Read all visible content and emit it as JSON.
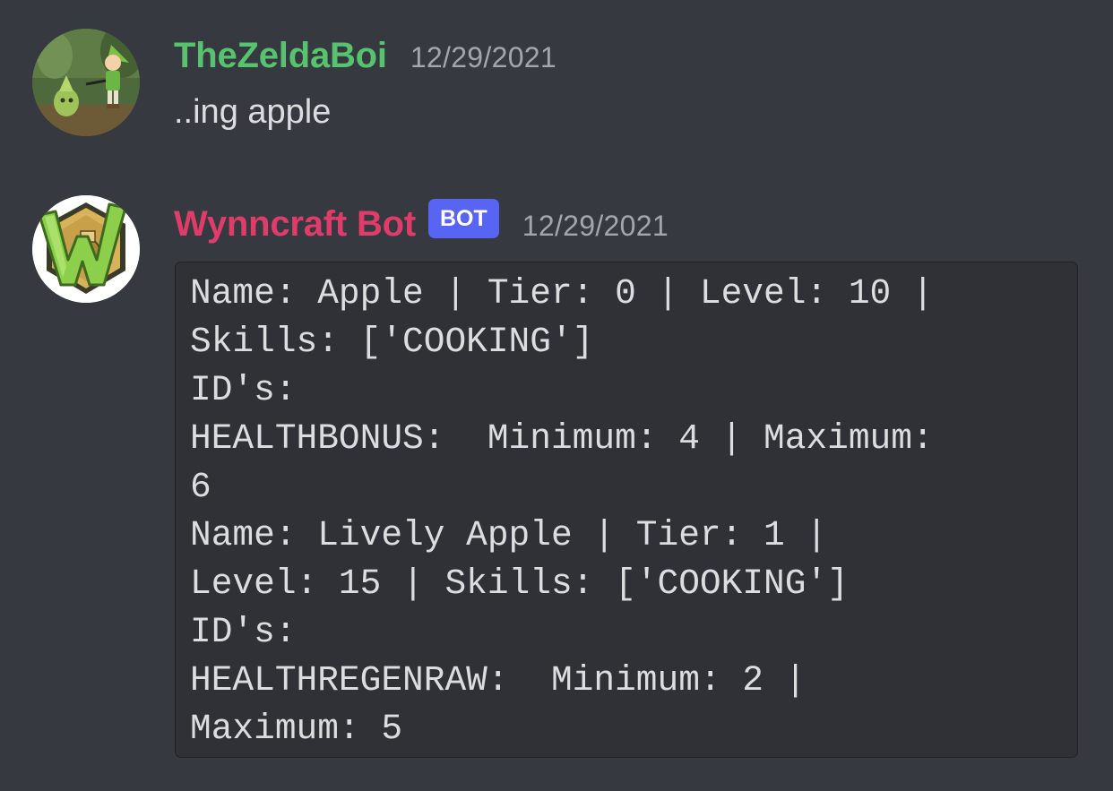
{
  "messages": [
    {
      "author": "TheZeldaBoi",
      "author_color": "#57c36f",
      "timestamp": "12/29/2021",
      "content": "..ing apple",
      "avatar_icon": "green-hero-character-avatar"
    },
    {
      "author": "Wynncraft Bot",
      "author_color": "#e03c6a",
      "bot_tag": "BOT",
      "timestamp": "12/29/2021",
      "avatar_icon": "wynncraft-w-logo-avatar",
      "code_lines": [
        "Name: Apple | Tier: 0 | Level: 10 |",
        "Skills: ['COOKING']",
        "ID's:",
        "HEALTHBONUS:  Minimum: 4 | Maximum:",
        "6",
        "Name: Lively Apple | Tier: 1 |",
        "Level: 15 | Skills: ['COOKING']",
        "ID's:",
        "HEALTHREGENRAW:  Minimum: 2 |",
        "Maximum: 5"
      ]
    }
  ],
  "colors": {
    "background": "#36393f",
    "codeblock_background": "#2f3136",
    "text": "#dcddde",
    "timestamp": "#a3a6aa",
    "bot_tag": "#5865f2"
  }
}
